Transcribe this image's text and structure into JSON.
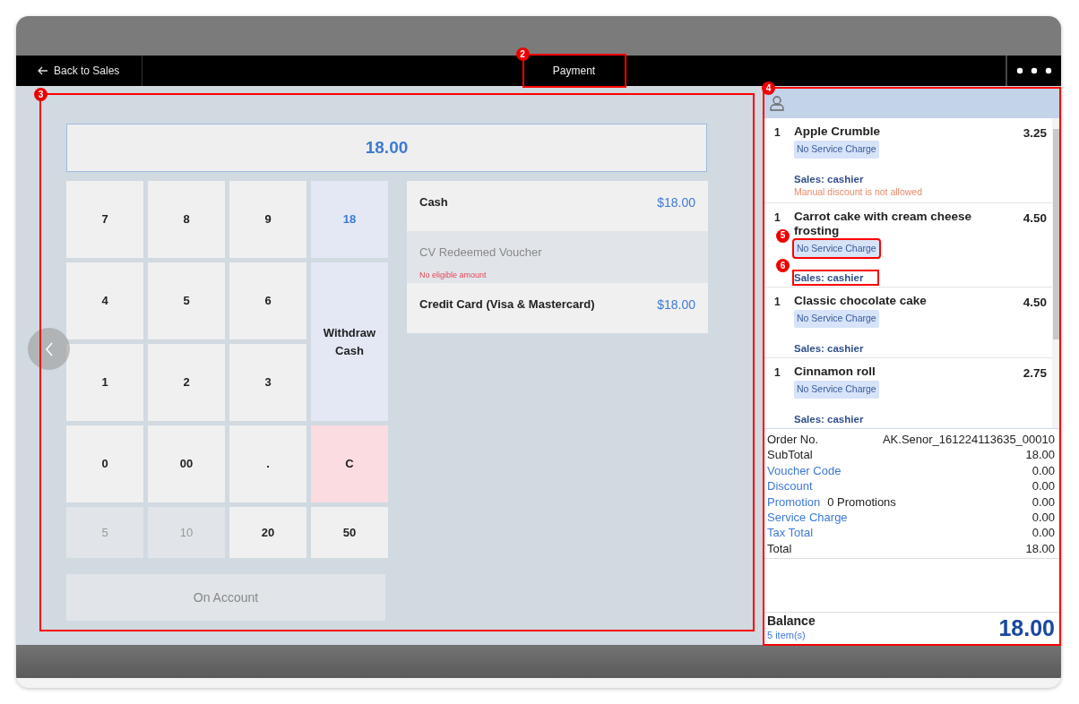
{
  "header": {
    "back_label": "Back to Sales",
    "title": "Payment",
    "title_callout": "2"
  },
  "left_pane": {
    "callout": "3",
    "amount_display": "18.00",
    "keypad": [
      {
        "label": "7",
        "kind": "digit",
        "disabled": false
      },
      {
        "label": "8",
        "kind": "digit",
        "disabled": false
      },
      {
        "label": "9",
        "kind": "digit",
        "disabled": false
      },
      {
        "label": "18",
        "kind": "amount",
        "disabled": false
      },
      {
        "label": "4",
        "kind": "digit",
        "disabled": false
      },
      {
        "label": "5",
        "kind": "digit",
        "disabled": false
      },
      {
        "label": "6",
        "kind": "digit",
        "disabled": false
      },
      {
        "label": "Withdraw Cash",
        "kind": "withdraw",
        "disabled": false
      },
      {
        "label": "1",
        "kind": "digit",
        "disabled": false
      },
      {
        "label": "2",
        "kind": "digit",
        "disabled": false
      },
      {
        "label": "3",
        "kind": "digit",
        "disabled": false
      },
      {
        "label": "0",
        "kind": "digit",
        "disabled": false
      },
      {
        "label": "00",
        "kind": "digit",
        "disabled": false
      },
      {
        "label": ".",
        "kind": "digit",
        "disabled": false
      },
      {
        "label": "C",
        "kind": "clear",
        "disabled": false
      },
      {
        "label": "5",
        "kind": "digit",
        "disabled": true
      },
      {
        "label": "10",
        "kind": "digit",
        "disabled": true
      },
      {
        "label": "20",
        "kind": "digit",
        "disabled": false
      },
      {
        "label": "50",
        "kind": "digit",
        "disabled": false
      }
    ],
    "on_account": {
      "label": "On Account",
      "disabled": true
    },
    "payment_methods": [
      {
        "name": "Cash",
        "amount": "$18.00",
        "disabled": false
      },
      {
        "name": "CV Redeemed Voucher",
        "note": "No eligible amount",
        "disabled": true
      },
      {
        "name": "Credit Card (Visa & Mastercard)",
        "amount": "$18.00",
        "disabled": false
      }
    ]
  },
  "order_panel": {
    "callout": "4",
    "items": [
      {
        "qty": "1",
        "name": "Apple Crumble",
        "price": "3.25",
        "tag": "No Service Charge",
        "sales": "Sales: cashier",
        "warning": "Manual discount is not allowed"
      },
      {
        "qty": "1",
        "name": "Carrot cake with cream cheese frosting",
        "price": "4.50",
        "tag": "No Service Charge",
        "tag_callout": "5",
        "sales": "Sales: cashier",
        "sales_callout": "6"
      },
      {
        "qty": "1",
        "name": "Classic chocolate cake",
        "price": "4.50",
        "tag": "No Service Charge",
        "sales": "Sales: cashier"
      },
      {
        "qty": "1",
        "name": "Cinnamon roll",
        "price": "2.75",
        "tag": "No Service Charge",
        "sales": "Sales: cashier"
      }
    ],
    "summary": [
      {
        "label": "Order No.",
        "value": "AK.Senor_161224113635_00010",
        "link": false
      },
      {
        "label": "SubTotal",
        "value": "18.00",
        "link": false
      },
      {
        "label": "Voucher Code",
        "value": "0.00",
        "link": true
      },
      {
        "label": "Discount",
        "value": "0.00",
        "link": true
      },
      {
        "label": "Promotion",
        "extra": "0 Promotions",
        "value": "0.00",
        "link": true
      },
      {
        "label": "Service Charge",
        "value": "0.00",
        "link": true
      },
      {
        "label": "Tax Total",
        "value": "0.00",
        "link": true
      },
      {
        "label": "Total",
        "value": "18.00",
        "link": false
      }
    ],
    "balance_label": "Balance",
    "item_count": "5 item(s)",
    "balance": "18.00"
  }
}
